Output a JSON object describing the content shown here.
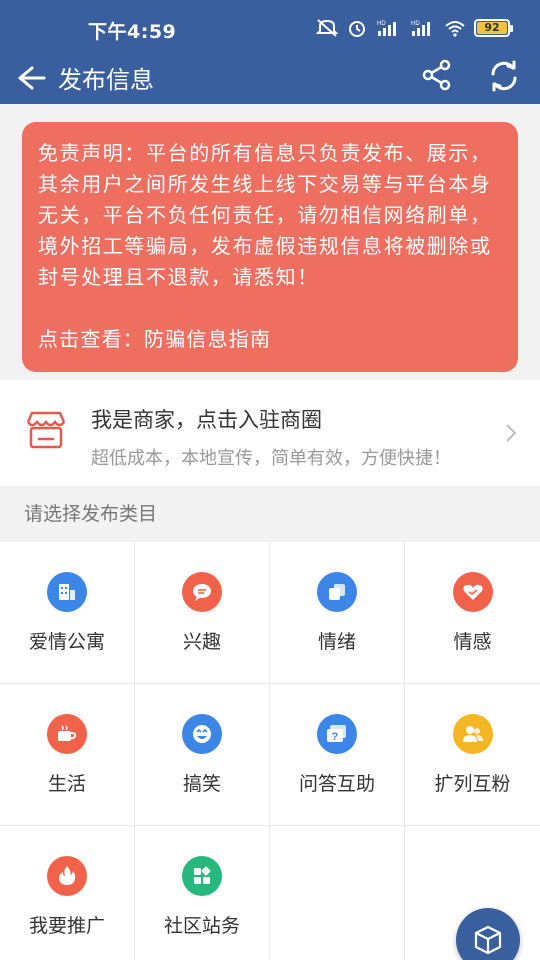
{
  "status_bar": {
    "time": "下午4:59",
    "battery": "92",
    "icons": [
      "mute-icon",
      "alarm-icon",
      "hd-signal-icon",
      "hd-signal-icon",
      "wifi-icon",
      "battery-icon"
    ]
  },
  "header": {
    "title": "发布信息",
    "back_icon": "back-arrow-icon",
    "share_icon": "share-icon",
    "refresh_icon": "refresh-icon"
  },
  "disclaimer": {
    "text": "免责声明：平台的所有信息只负责发布、展示，其余用户之间所发生线上线下交易等与平台本身无关，平台不负任何责任，请勿相信网络刷单，境外招工等骗局，发布虚假违规信息将被删除或封号处理且不退款，请悉知！",
    "link": "点击查看：防骗信息指南"
  },
  "merchant": {
    "title": "我是商家，点击入驻商圈",
    "subtitle": "超低成本，本地宣传，简单有效，方便快捷！"
  },
  "section_label": "请选择发布类目",
  "categories": [
    {
      "label": "爱情公寓",
      "icon": "apartment-icon",
      "color": "#3b86e6"
    },
    {
      "label": "兴趣",
      "icon": "chat-bubble-icon",
      "color": "#f0634a"
    },
    {
      "label": "情绪",
      "icon": "cards-icon",
      "color": "#3b86e6"
    },
    {
      "label": "情感",
      "icon": "heart-handshake-icon",
      "color": "#f0634a"
    },
    {
      "label": "生活",
      "icon": "coffee-cup-icon",
      "color": "#f0634a"
    },
    {
      "label": "搞笑",
      "icon": "laugh-face-icon",
      "color": "#3b86e6"
    },
    {
      "label": "问答互助",
      "icon": "question-icon",
      "color": "#3b86e6"
    },
    {
      "label": "扩列互粉",
      "icon": "users-icon",
      "color": "#f5b623"
    },
    {
      "label": "我要推广",
      "icon": "fire-icon",
      "color": "#f0634a"
    },
    {
      "label": "社区站务",
      "icon": "dashboard-icon",
      "color": "#27b87d"
    }
  ],
  "fab_icon": "cube-icon"
}
